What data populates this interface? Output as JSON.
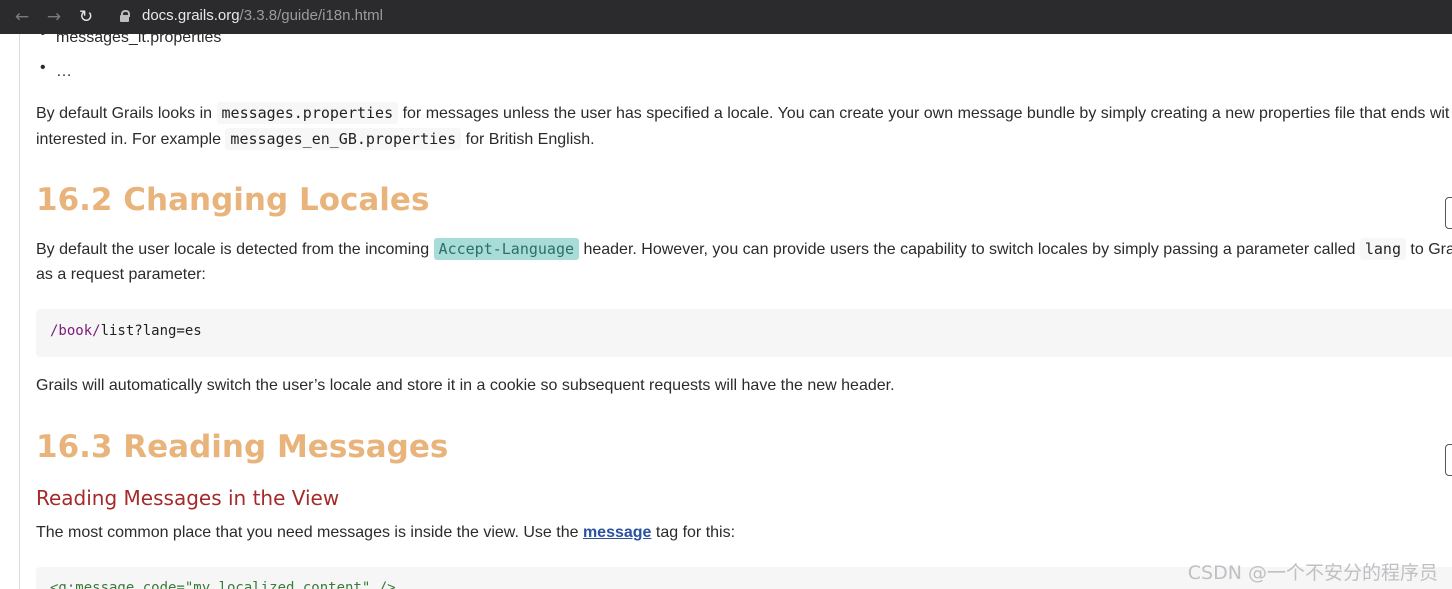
{
  "browser": {
    "url_host": "docs.grails.org",
    "url_path": "/3.3.8/guide/i18n.html"
  },
  "list_items": [
    "messages_it.properties",
    "…"
  ],
  "para1": {
    "t1": "By default Grails looks in ",
    "c1": "messages.properties",
    "t2": " for messages unless the user has specified a locale. You can create your own message bundle by simply creating a new properties file that ends wit",
    "t3": "interested in. For example ",
    "c2": "messages_en_GB.properties",
    "t4": " for British English."
  },
  "section_162": {
    "title": "16.2 Changing Locales",
    "t1": "By default the user locale is detected from the incoming ",
    "c1": "Accept-Language",
    "t2": " header. However, you can provide users the capability to switch locales by simply passing a parameter called ",
    "c2": "lang",
    "t3": " to Grails",
    "t4": "as a request parameter:",
    "code_path": "/book/",
    "code_rest": "list?lang=es",
    "after": "Grails will automatically switch the user’s locale and store it in a cookie so subsequent requests will have the new header."
  },
  "section_163": {
    "title": "16.3 Reading Messages",
    "subtitle": "Reading Messages in the View",
    "t1": "The most common place that you need messages is inside the view. Use the ",
    "link": "message",
    "t2": " tag for this:",
    "code_line": "<g:message code=\"my.localized.content\" />"
  },
  "watermark": "CSDN @一个不安分的程序员"
}
